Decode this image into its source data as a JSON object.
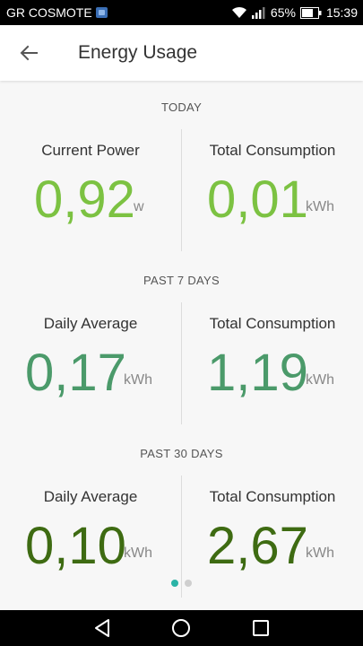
{
  "status_bar": {
    "carrier": "GR COSMOTE",
    "battery": "65%",
    "time": "15:39"
  },
  "app_bar": {
    "title": "Energy Usage"
  },
  "sections": [
    {
      "title": "TODAY",
      "left": {
        "label": "Current Power",
        "value": "0,92",
        "unit": "w",
        "color": "#7cc242"
      },
      "right": {
        "label": "Total Consumption",
        "value": "0,01",
        "unit": "kWh",
        "color": "#7cc242"
      }
    },
    {
      "title": "PAST 7 DAYS",
      "left": {
        "label": "Daily Average",
        "value": "0,17",
        "unit": "kWh",
        "color": "#4b9a6a"
      },
      "right": {
        "label": "Total Consumption",
        "value": "1,19",
        "unit": "kWh",
        "color": "#4b9a6a"
      }
    },
    {
      "title": "PAST 30 DAYS",
      "left": {
        "label": "Daily Average",
        "value": "0,10",
        "unit": "kWh",
        "color": "#3e6b12"
      },
      "right": {
        "label": "Total Consumption",
        "value": "2,67",
        "unit": "kWh",
        "color": "#3e6b12"
      }
    }
  ],
  "page_indicator": {
    "pages": 2,
    "active": 0,
    "active_color": "#2ab3a6"
  },
  "icons": {
    "back": "arrow-left-icon",
    "wifi": "wifi-icon",
    "signal": "signal-icon",
    "battery": "battery-icon",
    "nav_back": "triangle-back-icon",
    "nav_home": "circle-home-icon",
    "nav_recent": "square-recent-icon"
  }
}
